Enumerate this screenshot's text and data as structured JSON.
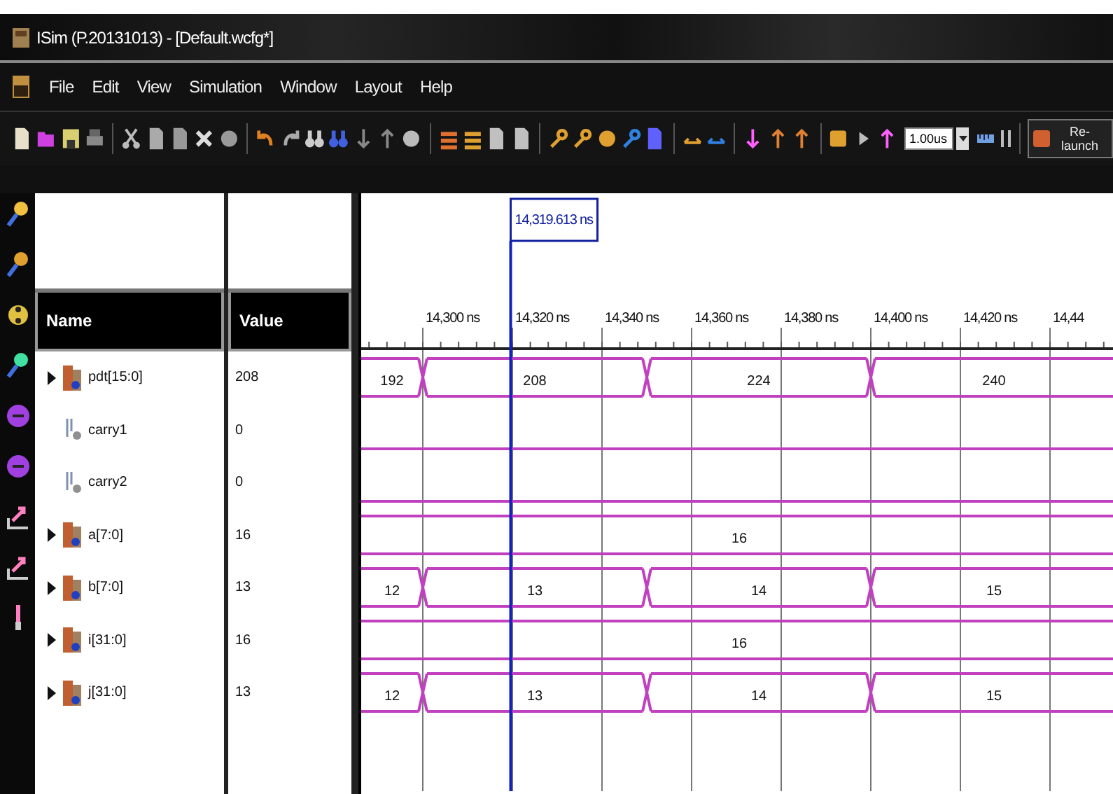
{
  "window": {
    "title": "ISim (P.20131013) - [Default.wcfg*]"
  },
  "menu": [
    "File",
    "Edit",
    "View",
    "Simulation",
    "Window",
    "Layout",
    "Help"
  ],
  "toolbar": {
    "time_field": {
      "value": "1.00us"
    },
    "relaunch_button": "Re-launch"
  },
  "columns": {
    "name": "Name",
    "value": "Value"
  },
  "signals": [
    {
      "name": "pdt[15:0]",
      "value": "208",
      "kind": "bus",
      "segments": [
        {
          "label": "192"
        },
        {
          "label": "208"
        },
        {
          "label": "224"
        },
        {
          "label": "240"
        }
      ]
    },
    {
      "name": "carry1",
      "value": "0",
      "kind": "bit"
    },
    {
      "name": "carry2",
      "value": "0",
      "kind": "bit"
    },
    {
      "name": "a[7:0]",
      "value": "16",
      "kind": "bus",
      "segments": [
        {
          "label": "16"
        }
      ]
    },
    {
      "name": "b[7:0]",
      "value": "13",
      "kind": "bus",
      "segments": [
        {
          "label": "12"
        },
        {
          "label": "13"
        },
        {
          "label": "14"
        },
        {
          "label": "15"
        }
      ]
    },
    {
      "name": "i[31:0]",
      "value": "16",
      "kind": "bus",
      "segments": [
        {
          "label": "16"
        }
      ]
    },
    {
      "name": "j[31:0]",
      "value": "13",
      "kind": "bus",
      "segments": [
        {
          "label": "12"
        },
        {
          "label": "13"
        },
        {
          "label": "14"
        },
        {
          "label": "15"
        }
      ]
    }
  ],
  "timeline": {
    "cursor": "14,319.613 ns",
    "ticks": [
      "14,300 ns",
      "14,320 ns",
      "14,340 ns",
      "14,360 ns",
      "14,380 ns",
      "14,400 ns",
      "14,420 ns",
      "14,44"
    ]
  }
}
